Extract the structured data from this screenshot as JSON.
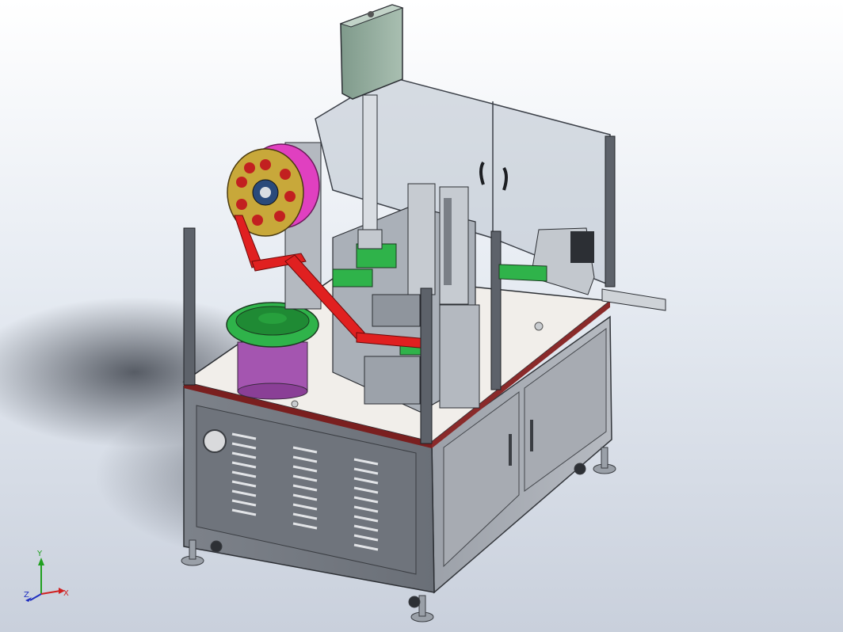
{
  "viewport": {
    "background_top": "#ffffff",
    "background_bottom": "#c9d0dc",
    "model": {
      "parts": [
        {
          "name": "control-box",
          "color": "#8fa89a"
        },
        {
          "name": "tape-reel",
          "color": "#c8a83a",
          "rim_color": "#e040c0"
        },
        {
          "name": "vibratory-bowl-feeder",
          "color": "#2fb34a",
          "base_color": "#a455b0"
        },
        {
          "name": "belt",
          "color": "#e02020"
        },
        {
          "name": "guard-panels",
          "color": "#b9c3cd"
        },
        {
          "name": "cabinet",
          "color": "#8f949c"
        },
        {
          "name": "table-top",
          "color": "#f1eeea"
        }
      ]
    }
  },
  "triad": {
    "x_label": "X",
    "y_label": "Y",
    "z_label": "Z",
    "x_color": "#d02020",
    "y_color": "#20a020",
    "z_color": "#2030c0"
  }
}
